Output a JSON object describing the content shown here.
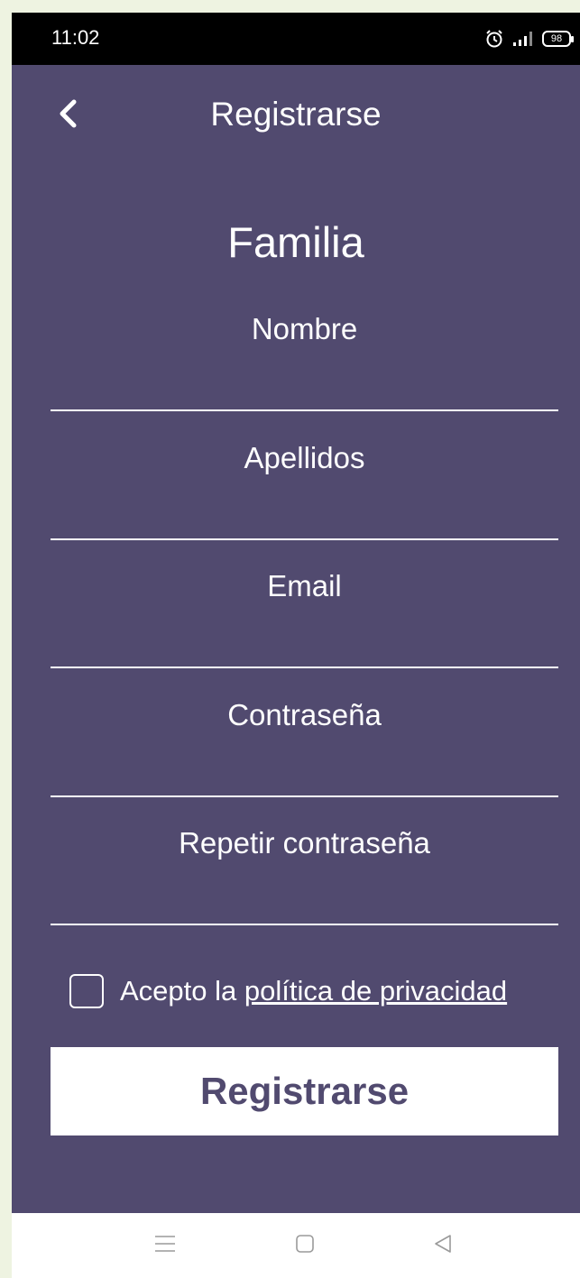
{
  "status_bar": {
    "time": "11:02",
    "battery": "98",
    "icons": [
      "alarm-icon",
      "signal-icon",
      "battery-icon"
    ]
  },
  "header": {
    "back_icon": "chevron-left-icon",
    "title": "Registrarse"
  },
  "form": {
    "section_title": "Familia",
    "fields": [
      {
        "label": "Nombre",
        "value": ""
      },
      {
        "label": "Apellidos",
        "value": ""
      },
      {
        "label": "Email",
        "value": ""
      },
      {
        "label": "Contraseña",
        "value": ""
      },
      {
        "label": "Repetir contraseña",
        "value": ""
      }
    ],
    "consent": {
      "checked": false,
      "prefix": "Acepto la",
      "link": "política de privacidad"
    },
    "submit_label": "Registrarse"
  },
  "nav_bar": {
    "icons": [
      "menu-icon",
      "home-icon",
      "back-triangle-icon"
    ]
  },
  "colors": {
    "background": "#514a6f",
    "status_bar": "#000000",
    "button_bg": "#ffffff",
    "button_text": "#514a6f",
    "outer": "#eef3e1"
  }
}
